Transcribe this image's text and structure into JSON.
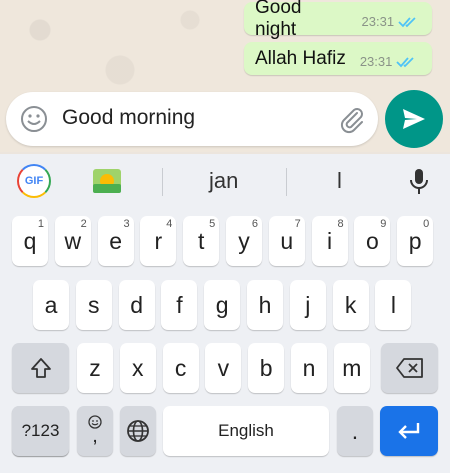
{
  "messages": [
    {
      "text": "Good night",
      "time": "23:31"
    },
    {
      "text": "Allah Hafiz",
      "time": "23:31"
    }
  ],
  "input": {
    "value": "Good morning"
  },
  "keyboard": {
    "gif_label": "GIF",
    "suggestions": [
      "jan",
      "l"
    ],
    "row1": [
      {
        "label": "q",
        "hint": "1"
      },
      {
        "label": "w",
        "hint": "2"
      },
      {
        "label": "e",
        "hint": "3"
      },
      {
        "label": "r",
        "hint": "4"
      },
      {
        "label": "t",
        "hint": "5"
      },
      {
        "label": "y",
        "hint": "6"
      },
      {
        "label": "u",
        "hint": "7"
      },
      {
        "label": "i",
        "hint": "8"
      },
      {
        "label": "o",
        "hint": "9"
      },
      {
        "label": "p",
        "hint": "0"
      }
    ],
    "row2": [
      "a",
      "s",
      "d",
      "f",
      "g",
      "h",
      "j",
      "k",
      "l"
    ],
    "row3": [
      "z",
      "x",
      "c",
      "v",
      "b",
      "n",
      "m"
    ],
    "symbols_label": "?123",
    "comma_label": ",",
    "space_label": "English",
    "period_label": "."
  },
  "colors": {
    "accent": "#009688",
    "bubble": "#dcf8c6",
    "enter": "#1a73e8"
  }
}
